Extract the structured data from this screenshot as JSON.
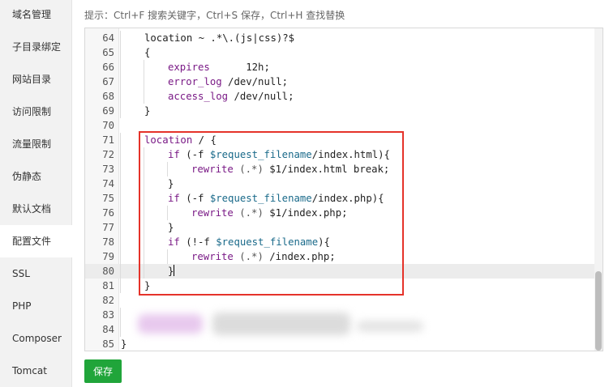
{
  "sidebar": {
    "items": [
      {
        "label": "域名管理"
      },
      {
        "label": "子目录绑定"
      },
      {
        "label": "网站目录"
      },
      {
        "label": "访问限制"
      },
      {
        "label": "流量限制"
      },
      {
        "label": "伪静态"
      },
      {
        "label": "默认文档"
      },
      {
        "label": "配置文件",
        "active": true
      },
      {
        "label": "SSL"
      },
      {
        "label": "PHP"
      },
      {
        "label": "Composer"
      },
      {
        "label": "Tomcat"
      }
    ]
  },
  "hint": "提示：Ctrl+F 搜索关键字，Ctrl+S 保存，Ctrl+H 查找替换",
  "editor": {
    "current_line": 80,
    "lines": [
      {
        "n": "64",
        "indent": 1,
        "html": "location ~ .*\\.(js|css)?$"
      },
      {
        "n": "65",
        "indent": 1,
        "html": "{"
      },
      {
        "n": "66",
        "indent": 2,
        "html": "<span class=\"kw\">expires</span>      12h;"
      },
      {
        "n": "67",
        "indent": 2,
        "html": "<span class=\"kw\">error_log</span> /dev/null;"
      },
      {
        "n": "68",
        "indent": 2,
        "html": "<span class=\"kw\">access_log</span> /dev/null;"
      },
      {
        "n": "69",
        "indent": 1,
        "html": "}"
      },
      {
        "n": "70",
        "indent": 0,
        "html": ""
      },
      {
        "n": "71",
        "indent": 1,
        "html": "<span class=\"kw\">location</span> / {"
      },
      {
        "n": "72",
        "indent": 2,
        "html": "<span class=\"kw\">if</span> (-f <span class=\"var\">$request_filename</span>/index.html){"
      },
      {
        "n": "73",
        "indent": 3,
        "html": "<span class=\"kw\">rewrite</span> <span class=\"op\">(.*)</span> $1/index.html break;"
      },
      {
        "n": "74",
        "indent": 2,
        "html": "}"
      },
      {
        "n": "75",
        "indent": 2,
        "html": "<span class=\"kw\">if</span> (-f <span class=\"var\">$request_filename</span>/index.php){"
      },
      {
        "n": "76",
        "indent": 3,
        "html": "<span class=\"kw\">rewrite</span> <span class=\"op\">(.*)</span> $1/index.php;"
      },
      {
        "n": "77",
        "indent": 2,
        "html": "}"
      },
      {
        "n": "78",
        "indent": 2,
        "html": "<span class=\"kw\">if</span> (!-f <span class=\"var\">$request_filename</span>){"
      },
      {
        "n": "79",
        "indent": 3,
        "html": "<span class=\"kw\">rewrite</span> <span class=\"op\">(.*)</span> /index.php;"
      },
      {
        "n": "80",
        "indent": 2,
        "html": "}<span class=\"cursor\"></span>"
      },
      {
        "n": "81",
        "indent": 1,
        "html": "}"
      },
      {
        "n": "82",
        "indent": 0,
        "html": ""
      },
      {
        "n": "83",
        "indent": 1,
        "html": ""
      },
      {
        "n": "84",
        "indent": 1,
        "html": ""
      },
      {
        "n": "85",
        "indent": 0,
        "html": "}"
      }
    ]
  },
  "save_label": "保存",
  "colors": {
    "accent_green": "#20a53a",
    "highlight_red": "#e5332a",
    "keyword": "#7a1a86",
    "variable": "#1a6a8a"
  }
}
